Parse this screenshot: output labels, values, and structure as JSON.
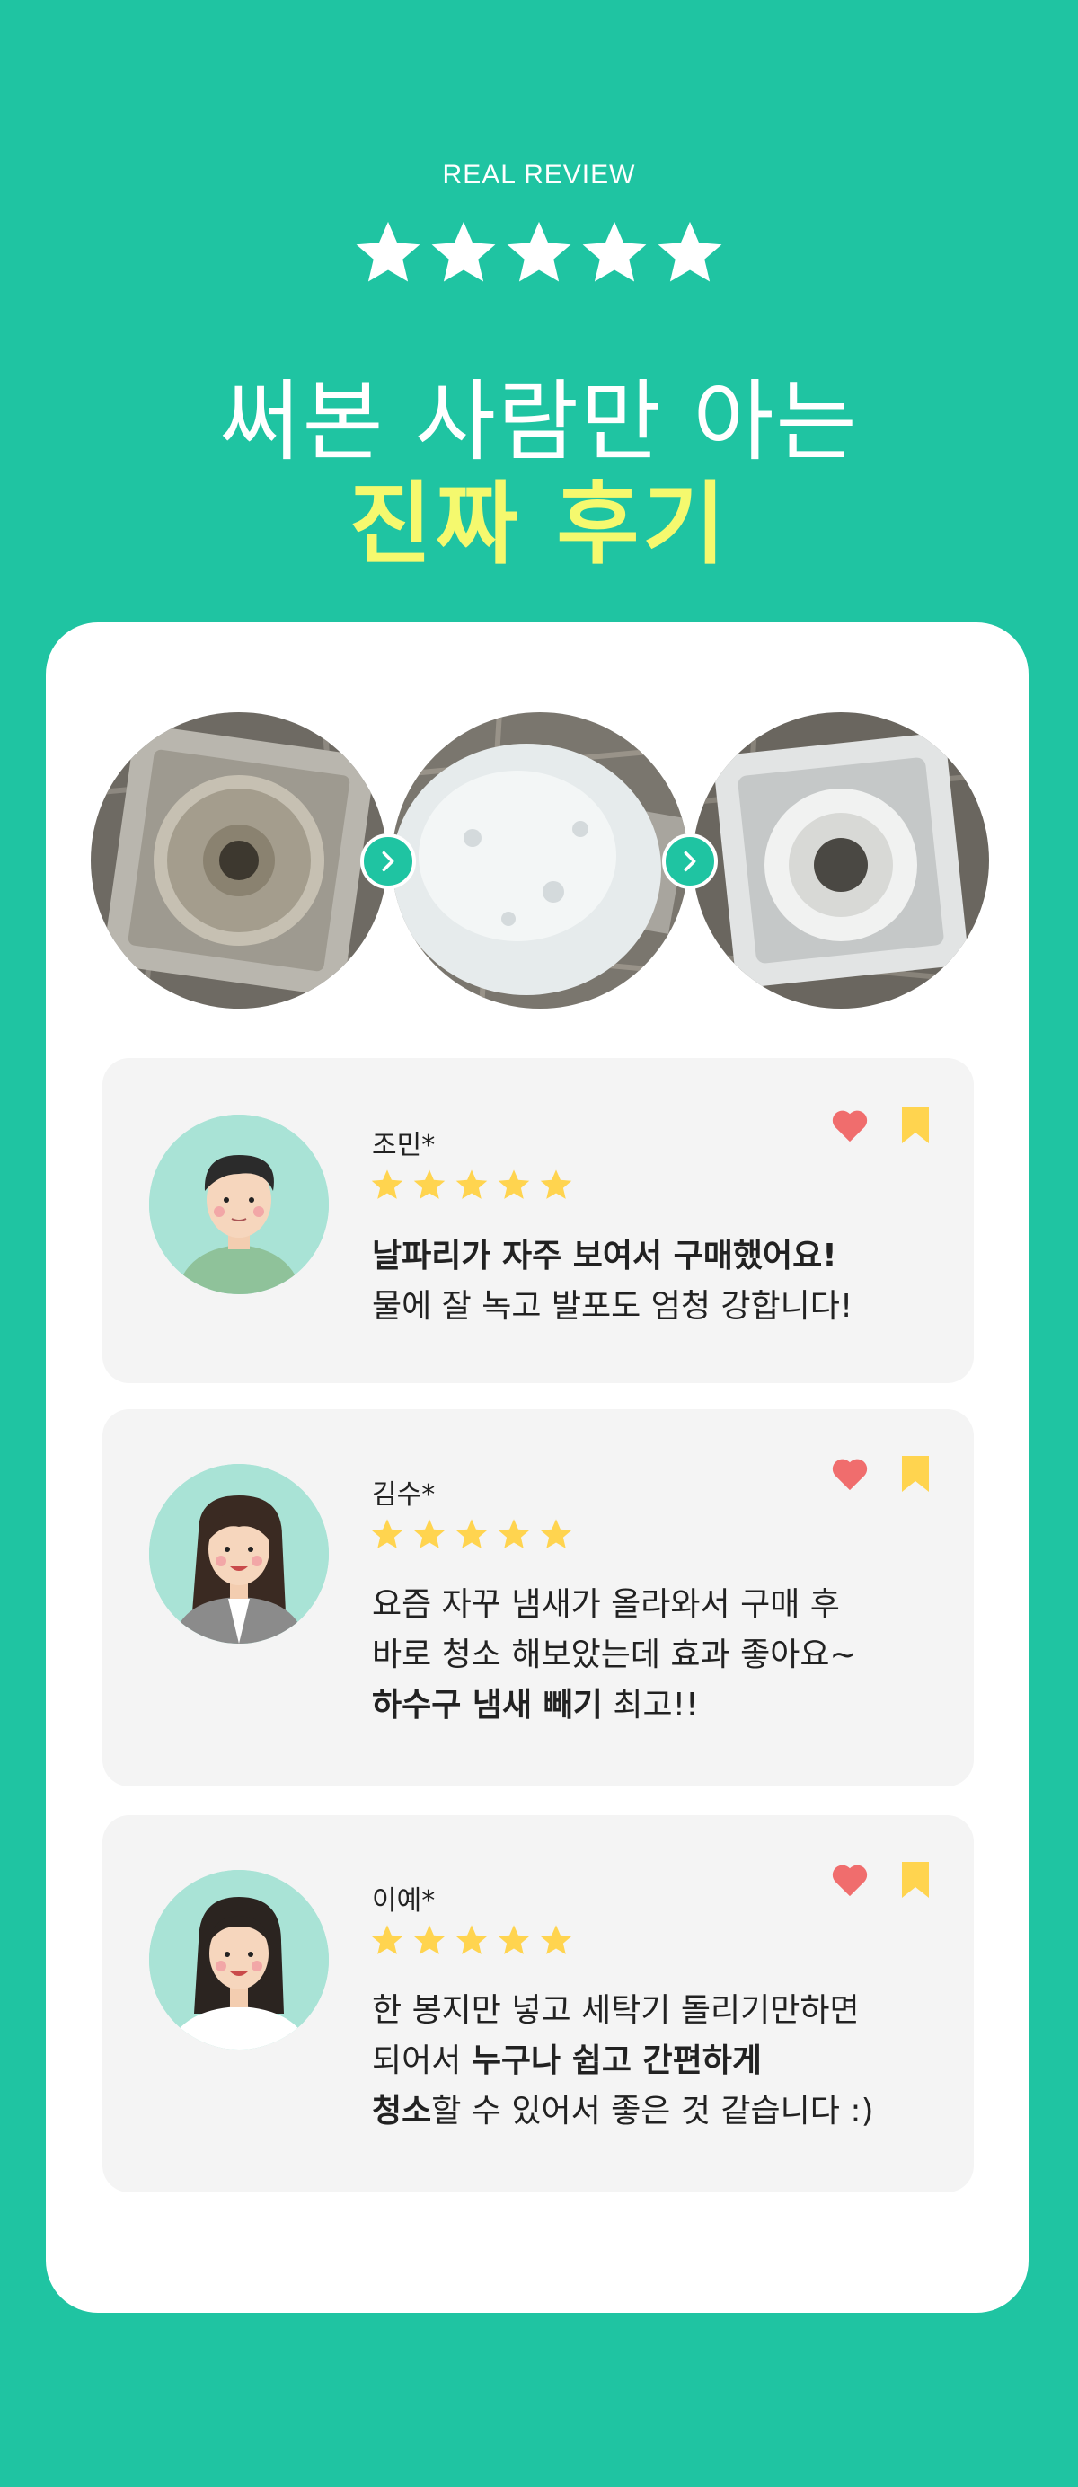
{
  "header": {
    "eyebrow": "REAL REVIEW",
    "star_count": 5,
    "title_line1": "써본 사람만 아는",
    "title_line2": "진짜 후기"
  },
  "colors": {
    "background": "#1fc4a2",
    "title_highlight": "#f5f96e",
    "star": "#ffd44f",
    "heart": "#f06d6d",
    "bookmark": "#ffd44f",
    "review_bg": "#f4f4f4"
  },
  "photos": [
    {
      "name": "drain-before-photo"
    },
    {
      "name": "drain-foam-photo"
    },
    {
      "name": "drain-after-photo"
    }
  ],
  "reviews": [
    {
      "name": "조민*",
      "rating": 5,
      "line1_bold": "날파리가 자주 보여서 구매했어요!",
      "line2": "물에 잘 녹고 발포도 엄청 강합니다!"
    },
    {
      "name": "김수*",
      "rating": 5,
      "line1": "요즘 자꾸 냄새가 올라와서 구매 후",
      "line2": "바로 청소 해보았는데 효과 좋아요~",
      "line3_bold": "하수구 냄새 빼기",
      "line3_rest": " 최고!!"
    },
    {
      "name": "이예*",
      "rating": 5,
      "line1": "한 봉지만 넣고 세탁기 돌리기만하면",
      "line2_plain": "되어서 ",
      "line2_bold": "누구나 쉽고 간편하게",
      "line3_bold": "청소",
      "line3_rest": "할 수 있어서 좋은 것 같습니다 :)"
    }
  ]
}
